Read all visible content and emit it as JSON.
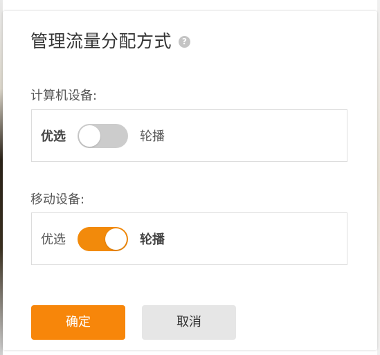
{
  "dialog": {
    "title": "管理流量分配方式",
    "help_icon": "question-mark-icon",
    "help_glyph": "?"
  },
  "pc_section": {
    "label": "计算机设备:",
    "left_option": "优选",
    "right_option": "轮播",
    "selected": "优选",
    "toggle_state": "off"
  },
  "mobile_section": {
    "label": "移动设备:",
    "left_option": "优选",
    "right_option": "轮播",
    "selected": "轮播",
    "toggle_state": "on"
  },
  "buttons": {
    "confirm_label": "确定",
    "cancel_label": "取消"
  },
  "colors": {
    "accent": "#f7860a",
    "toggle_on": "#f28a0b",
    "toggle_off": "#cccccc",
    "cancel_bg": "#e6e6e6",
    "border": "#dcdcdc",
    "text": "#555555"
  }
}
